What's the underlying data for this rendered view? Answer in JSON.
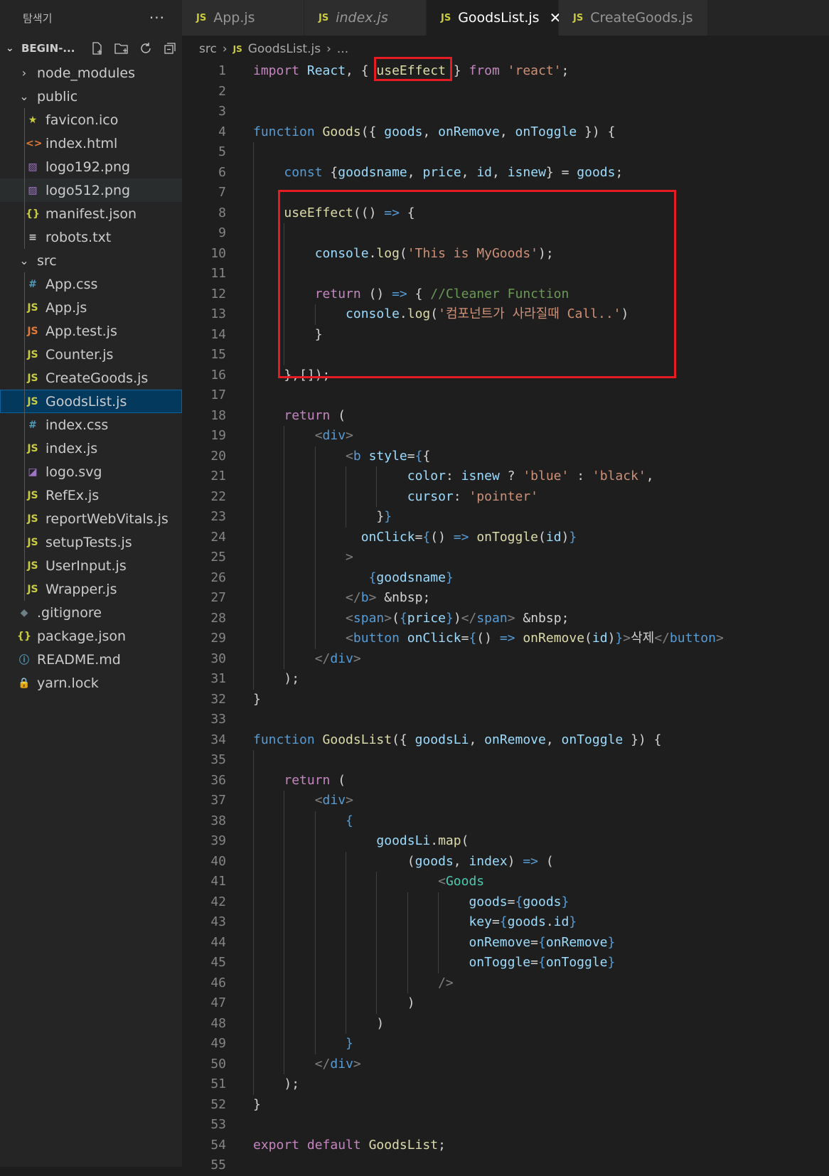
{
  "explorer": {
    "title": "탐색기",
    "more": "···",
    "root": "BEGIN-...",
    "items": [
      {
        "label": "node_modules",
        "type": "folder-closed",
        "icon": "›",
        "iconColor": "#cccccc",
        "depth": 1
      },
      {
        "label": "public",
        "type": "folder-open",
        "icon": "⌄",
        "iconColor": "#cccccc",
        "depth": 1
      },
      {
        "label": "favicon.ico",
        "type": "file",
        "icon": "★",
        "iconColor": "#cbcb41",
        "depth": 2
      },
      {
        "label": "index.html",
        "type": "file",
        "icon": "<>",
        "iconColor": "#e37933",
        "depth": 2
      },
      {
        "label": "logo192.png",
        "type": "file",
        "icon": "▨",
        "iconColor": "#a074c4",
        "depth": 2
      },
      {
        "label": "logo512.png",
        "type": "file",
        "icon": "▨",
        "iconColor": "#a074c4",
        "depth": 2,
        "hover": true
      },
      {
        "label": "manifest.json",
        "type": "file",
        "icon": "{}",
        "iconColor": "#cbcb41",
        "depth": 2
      },
      {
        "label": "robots.txt",
        "type": "file",
        "icon": "≡",
        "iconColor": "#cccccc",
        "depth": 2
      },
      {
        "label": "src",
        "type": "folder-open",
        "icon": "⌄",
        "iconColor": "#cccccc",
        "depth": 1
      },
      {
        "label": "App.css",
        "type": "file",
        "icon": "#",
        "iconColor": "#519aba",
        "depth": 2
      },
      {
        "label": "App.js",
        "type": "file",
        "icon": "JS",
        "iconColor": "#cbcb41",
        "depth": 2
      },
      {
        "label": "App.test.js",
        "type": "file",
        "icon": "JS",
        "iconColor": "#e37933",
        "depth": 2
      },
      {
        "label": "Counter.js",
        "type": "file",
        "icon": "JS",
        "iconColor": "#cbcb41",
        "depth": 2
      },
      {
        "label": "CreateGoods.js",
        "type": "file",
        "icon": "JS",
        "iconColor": "#cbcb41",
        "depth": 2
      },
      {
        "label": "GoodsList.js",
        "type": "file",
        "icon": "JS",
        "iconColor": "#cbcb41",
        "depth": 2,
        "selected": true
      },
      {
        "label": "index.css",
        "type": "file",
        "icon": "#",
        "iconColor": "#519aba",
        "depth": 2
      },
      {
        "label": "index.js",
        "type": "file",
        "icon": "JS",
        "iconColor": "#cbcb41",
        "depth": 2
      },
      {
        "label": "logo.svg",
        "type": "file",
        "icon": "◪",
        "iconColor": "#a074c4",
        "depth": 2
      },
      {
        "label": "RefEx.js",
        "type": "file",
        "icon": "JS",
        "iconColor": "#cbcb41",
        "depth": 2
      },
      {
        "label": "reportWebVitals.js",
        "type": "file",
        "icon": "JS",
        "iconColor": "#cbcb41",
        "depth": 2
      },
      {
        "label": "setupTests.js",
        "type": "file",
        "icon": "JS",
        "iconColor": "#cbcb41",
        "depth": 2
      },
      {
        "label": "UserInput.js",
        "type": "file",
        "icon": "JS",
        "iconColor": "#cbcb41",
        "depth": 2
      },
      {
        "label": "Wrapper.js",
        "type": "file",
        "icon": "JS",
        "iconColor": "#cbcb41",
        "depth": 2
      },
      {
        "label": ".gitignore",
        "type": "file",
        "icon": "◆",
        "iconColor": "#6d8086",
        "depth": 1
      },
      {
        "label": "package.json",
        "type": "file",
        "icon": "{}",
        "iconColor": "#cbcb41",
        "depth": 1
      },
      {
        "label": "README.md",
        "type": "file",
        "icon": "ⓘ",
        "iconColor": "#519aba",
        "depth": 1
      },
      {
        "label": "yarn.lock",
        "type": "file",
        "icon": "🔒",
        "iconColor": "#519aba",
        "depth": 1
      }
    ]
  },
  "tabs": [
    {
      "label": "App.js",
      "active": false,
      "italic": false
    },
    {
      "label": "index.js",
      "active": false,
      "italic": true
    },
    {
      "label": "GoodsList.js",
      "active": true,
      "italic": false,
      "close": "✕"
    },
    {
      "label": "CreateGoods.js",
      "active": false,
      "italic": false
    }
  ],
  "tab_js_badge": "JS",
  "breadcrumb": {
    "folder": "src",
    "file": "GoodsList.js",
    "more": "..."
  },
  "code_lines": [
    [
      [
        "kw",
        "import "
      ],
      [
        "vr",
        "React"
      ],
      [
        "pn",
        ", { "
      ],
      [
        "fn",
        "useEffect"
      ],
      [
        "pn",
        " } "
      ],
      [
        "kw",
        "from "
      ],
      [
        "st",
        "'react'"
      ],
      [
        "pn",
        ";"
      ]
    ],
    [],
    [],
    [
      [
        "kb",
        "function "
      ],
      [
        "fn",
        "Goods"
      ],
      [
        "pn",
        "({ "
      ],
      [
        "vr",
        "goods"
      ],
      [
        "pn",
        ", "
      ],
      [
        "vr",
        "onRemove"
      ],
      [
        "pn",
        ", "
      ],
      [
        "vr",
        "onToggle"
      ],
      [
        "pn",
        " }) {"
      ]
    ],
    [],
    [
      [
        "ws",
        "    "
      ],
      [
        "kb",
        "const "
      ],
      [
        "pn",
        "{"
      ],
      [
        "vr",
        "goodsname"
      ],
      [
        "pn",
        ", "
      ],
      [
        "vr",
        "price"
      ],
      [
        "pn",
        ", "
      ],
      [
        "vr",
        "id"
      ],
      [
        "pn",
        ", "
      ],
      [
        "vr",
        "isnew"
      ],
      [
        "pn",
        "} = "
      ],
      [
        "vr",
        "goods"
      ],
      [
        "pn",
        ";"
      ]
    ],
    [],
    [
      [
        "ws",
        "    "
      ],
      [
        "fn",
        "useEffect"
      ],
      [
        "pn",
        "(() "
      ],
      [
        "kb",
        "=>"
      ],
      [
        "pn",
        " {"
      ]
    ],
    [],
    [
      [
        "ws",
        "        "
      ],
      [
        "vr",
        "console"
      ],
      [
        "pn",
        "."
      ],
      [
        "fn",
        "log"
      ],
      [
        "pn",
        "("
      ],
      [
        "st",
        "'This is MyGoods'"
      ],
      [
        "pn",
        ");"
      ]
    ],
    [],
    [
      [
        "ws",
        "        "
      ],
      [
        "kw",
        "return "
      ],
      [
        "pn",
        "() "
      ],
      [
        "kb",
        "=>"
      ],
      [
        "pn",
        " { "
      ],
      [
        "cm",
        "//Cleaner Function"
      ]
    ],
    [
      [
        "ws",
        "            "
      ],
      [
        "vr",
        "console"
      ],
      [
        "pn",
        "."
      ],
      [
        "fn",
        "log"
      ],
      [
        "pn",
        "("
      ],
      [
        "st",
        "'컴포넌트가 사라질때 Call..'"
      ],
      [
        "pn",
        ")"
      ]
    ],
    [
      [
        "ws",
        "        "
      ],
      [
        "pn",
        "}"
      ]
    ],
    [],
    [
      [
        "ws",
        "    "
      ],
      [
        "pn",
        "},[]);"
      ]
    ],
    [],
    [
      [
        "ws",
        "    "
      ],
      [
        "kw",
        "return "
      ],
      [
        "pn",
        "("
      ]
    ],
    [
      [
        "ws",
        "        "
      ],
      [
        "tg",
        "<"
      ],
      [
        "tn",
        "div"
      ],
      [
        "tg",
        ">"
      ]
    ],
    [
      [
        "ws",
        "            "
      ],
      [
        "tg",
        "<"
      ],
      [
        "tn",
        "b "
      ],
      [
        "vr",
        "style"
      ],
      [
        "pn",
        "="
      ],
      [
        "kb",
        "{"
      ],
      [
        "pn",
        "{"
      ]
    ],
    [
      [
        "ws",
        "                    "
      ],
      [
        "vr",
        "color"
      ],
      [
        "pn",
        ": "
      ],
      [
        "vr",
        "isnew"
      ],
      [
        "pn",
        " ? "
      ],
      [
        "st",
        "'blue'"
      ],
      [
        "pn",
        " : "
      ],
      [
        "st",
        "'black'"
      ],
      [
        "pn",
        ","
      ]
    ],
    [
      [
        "ws",
        "                    "
      ],
      [
        "vr",
        "cursor"
      ],
      [
        "pn",
        ": "
      ],
      [
        "st",
        "'pointer'"
      ]
    ],
    [
      [
        "ws",
        "                "
      ],
      [
        "pn",
        "}"
      ],
      [
        "kb",
        "}"
      ]
    ],
    [
      [
        "ws",
        "              "
      ],
      [
        "vr",
        "onClick"
      ],
      [
        "pn",
        "="
      ],
      [
        "kb",
        "{"
      ],
      [
        "pn",
        "() "
      ],
      [
        "kb",
        "=>"
      ],
      [
        "pn",
        " "
      ],
      [
        "fn",
        "onToggle"
      ],
      [
        "pn",
        "("
      ],
      [
        "vr",
        "id"
      ],
      [
        "pn",
        ")"
      ],
      [
        "kb",
        "}"
      ]
    ],
    [
      [
        "ws",
        "            "
      ],
      [
        "tg",
        ">"
      ]
    ],
    [
      [
        "ws",
        "               "
      ],
      [
        "kb",
        "{"
      ],
      [
        "vr",
        "goodsname"
      ],
      [
        "kb",
        "}"
      ]
    ],
    [
      [
        "ws",
        "            "
      ],
      [
        "tg",
        "</"
      ],
      [
        "tn",
        "b"
      ],
      [
        "tg",
        ">"
      ],
      [
        "pn",
        " &nbsp;"
      ]
    ],
    [
      [
        "ws",
        "            "
      ],
      [
        "tg",
        "<"
      ],
      [
        "tn",
        "span"
      ],
      [
        "tg",
        ">"
      ],
      [
        "pn",
        "("
      ],
      [
        "kb",
        "{"
      ],
      [
        "vr",
        "price"
      ],
      [
        "kb",
        "}"
      ],
      [
        "pn",
        ")"
      ],
      [
        "tg",
        "</"
      ],
      [
        "tn",
        "span"
      ],
      [
        "tg",
        ">"
      ],
      [
        "pn",
        " &nbsp;"
      ]
    ],
    [
      [
        "ws",
        "            "
      ],
      [
        "tg",
        "<"
      ],
      [
        "tn",
        "button "
      ],
      [
        "vr",
        "onClick"
      ],
      [
        "pn",
        "="
      ],
      [
        "kb",
        "{"
      ],
      [
        "pn",
        "() "
      ],
      [
        "kb",
        "=>"
      ],
      [
        "pn",
        " "
      ],
      [
        "fn",
        "onRemove"
      ],
      [
        "pn",
        "("
      ],
      [
        "vr",
        "id"
      ],
      [
        "pn",
        ")"
      ],
      [
        "kb",
        "}"
      ],
      [
        "tg",
        ">"
      ],
      [
        "pn",
        "삭제"
      ],
      [
        "tg",
        "</"
      ],
      [
        "tn",
        "button"
      ],
      [
        "tg",
        ">"
      ]
    ],
    [
      [
        "ws",
        "        "
      ],
      [
        "tg",
        "</"
      ],
      [
        "tn",
        "div"
      ],
      [
        "tg",
        ">"
      ]
    ],
    [
      [
        "ws",
        "    "
      ],
      [
        "pn",
        ");"
      ]
    ],
    [
      [
        "pn",
        "}"
      ]
    ],
    [],
    [
      [
        "kb",
        "function "
      ],
      [
        "fn",
        "GoodsList"
      ],
      [
        "pn",
        "({ "
      ],
      [
        "vr",
        "goodsLi"
      ],
      [
        "pn",
        ", "
      ],
      [
        "vr",
        "onRemove"
      ],
      [
        "pn",
        ", "
      ],
      [
        "vr",
        "onToggle"
      ],
      [
        "pn",
        " }) {"
      ]
    ],
    [],
    [
      [
        "ws",
        "    "
      ],
      [
        "kw",
        "return "
      ],
      [
        "pn",
        "("
      ]
    ],
    [
      [
        "ws",
        "        "
      ],
      [
        "tg",
        "<"
      ],
      [
        "tn",
        "div"
      ],
      [
        "tg",
        ">"
      ]
    ],
    [
      [
        "ws",
        "            "
      ],
      [
        "kb",
        "{"
      ]
    ],
    [
      [
        "ws",
        "                "
      ],
      [
        "vr",
        "goodsLi"
      ],
      [
        "pn",
        "."
      ],
      [
        "fn",
        "map"
      ],
      [
        "pn",
        "("
      ]
    ],
    [
      [
        "ws",
        "                    "
      ],
      [
        "pn",
        "("
      ],
      [
        "vr",
        "goods"
      ],
      [
        "pn",
        ", "
      ],
      [
        "vr",
        "index"
      ],
      [
        "pn",
        ") "
      ],
      [
        "kb",
        "=>"
      ],
      [
        "pn",
        " ("
      ]
    ],
    [
      [
        "ws",
        "                        "
      ],
      [
        "tg",
        "<"
      ],
      [
        "cp",
        "Goods"
      ]
    ],
    [
      [
        "ws",
        "                            "
      ],
      [
        "vr",
        "goods"
      ],
      [
        "pn",
        "="
      ],
      [
        "kb",
        "{"
      ],
      [
        "vr",
        "goods"
      ],
      [
        "kb",
        "}"
      ]
    ],
    [
      [
        "ws",
        "                            "
      ],
      [
        "vr",
        "key"
      ],
      [
        "pn",
        "="
      ],
      [
        "kb",
        "{"
      ],
      [
        "vr",
        "goods"
      ],
      [
        "pn",
        "."
      ],
      [
        "vr",
        "id"
      ],
      [
        "kb",
        "}"
      ]
    ],
    [
      [
        "ws",
        "                            "
      ],
      [
        "vr",
        "onRemove"
      ],
      [
        "pn",
        "="
      ],
      [
        "kb",
        "{"
      ],
      [
        "vr",
        "onRemove"
      ],
      [
        "kb",
        "}"
      ]
    ],
    [
      [
        "ws",
        "                            "
      ],
      [
        "vr",
        "onToggle"
      ],
      [
        "pn",
        "="
      ],
      [
        "kb",
        "{"
      ],
      [
        "vr",
        "onToggle"
      ],
      [
        "kb",
        "}"
      ]
    ],
    [
      [
        "ws",
        "                        "
      ],
      [
        "tg",
        "/>"
      ]
    ],
    [
      [
        "ws",
        "                    "
      ],
      [
        "pn",
        ")"
      ]
    ],
    [
      [
        "ws",
        "                "
      ],
      [
        "pn",
        ")"
      ]
    ],
    [
      [
        "ws",
        "            "
      ],
      [
        "kb",
        "}"
      ]
    ],
    [
      [
        "ws",
        "        "
      ],
      [
        "tg",
        "</"
      ],
      [
        "tn",
        "div"
      ],
      [
        "tg",
        ">"
      ]
    ],
    [
      [
        "ws",
        "    "
      ],
      [
        "pn",
        ");"
      ]
    ],
    [
      [
        "pn",
        "}"
      ]
    ],
    [],
    [
      [
        "kw",
        "export "
      ],
      [
        "kw",
        "default "
      ],
      [
        "fn",
        "GoodsList"
      ],
      [
        "pn",
        ";"
      ]
    ],
    []
  ]
}
